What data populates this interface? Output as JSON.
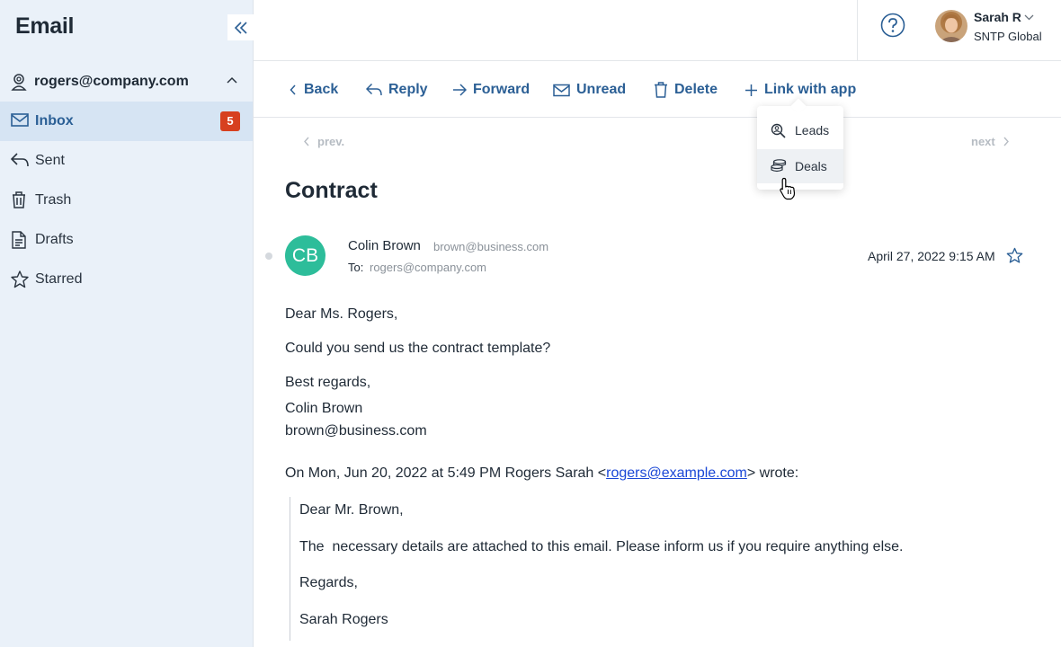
{
  "sidebar": {
    "title": "Email",
    "account": "rogers@company.com",
    "items": [
      {
        "label": "Inbox",
        "badge": "5"
      },
      {
        "label": "Sent"
      },
      {
        "label": "Trash"
      },
      {
        "label": "Drafts"
      },
      {
        "label": "Starred"
      }
    ]
  },
  "header": {
    "user_name": "Sarah R",
    "user_org": "SNTP Global"
  },
  "toolbar": {
    "back": "Back",
    "reply": "Reply",
    "forward": "Forward",
    "unread": "Unread",
    "delete": "Delete",
    "link_with_app": "Link with app"
  },
  "link_menu": {
    "items": [
      {
        "label": "Leads"
      },
      {
        "label": "Deals"
      }
    ]
  },
  "pager": {
    "prev": "prev.",
    "next": "next"
  },
  "message": {
    "subject": "Contract",
    "sender_initials": "CB",
    "sender_name": "Colin Brown",
    "sender_email": "brown@business.com",
    "to_label": "To:",
    "to_value": "rogers@company.com",
    "date": "April 27, 2022 9:15 AM",
    "body": [
      "Dear Ms. Rogers,",
      "Could you send us the contract template?",
      "Best regards,",
      "Colin Brown",
      "brown@business.com"
    ],
    "quote_intro_before": "On Mon, Jun 20, 2022 at 5:49 PM Rogers Sarah <",
    "quote_intro_link": "rogers@example.com",
    "quote_intro_after": "> wrote:",
    "quote": [
      "Dear Mr. Brown,",
      "The  necessary details are attached to this email. Please inform us if you require anything else.",
      "Regards,",
      "Sarah Rogers"
    ]
  },
  "colors": {
    "accent": "#2b5f95",
    "sidebar_bg": "#eaf1f9",
    "active_bg": "#d6e4f3",
    "badge": "#d7401f",
    "sender_avatar": "#2dbd9a",
    "link": "#1a47d6"
  },
  "icons": [
    "collapse-icon",
    "account-icon",
    "chevron-up-icon",
    "inbox-icon",
    "sent-icon",
    "trash-icon",
    "drafts-icon",
    "star-icon",
    "help-icon",
    "chevron-down-icon",
    "back-icon",
    "reply-icon",
    "forward-icon",
    "unread-icon",
    "delete-icon",
    "plus-icon",
    "leads-icon",
    "deals-icon",
    "pointer-cursor-icon"
  ]
}
